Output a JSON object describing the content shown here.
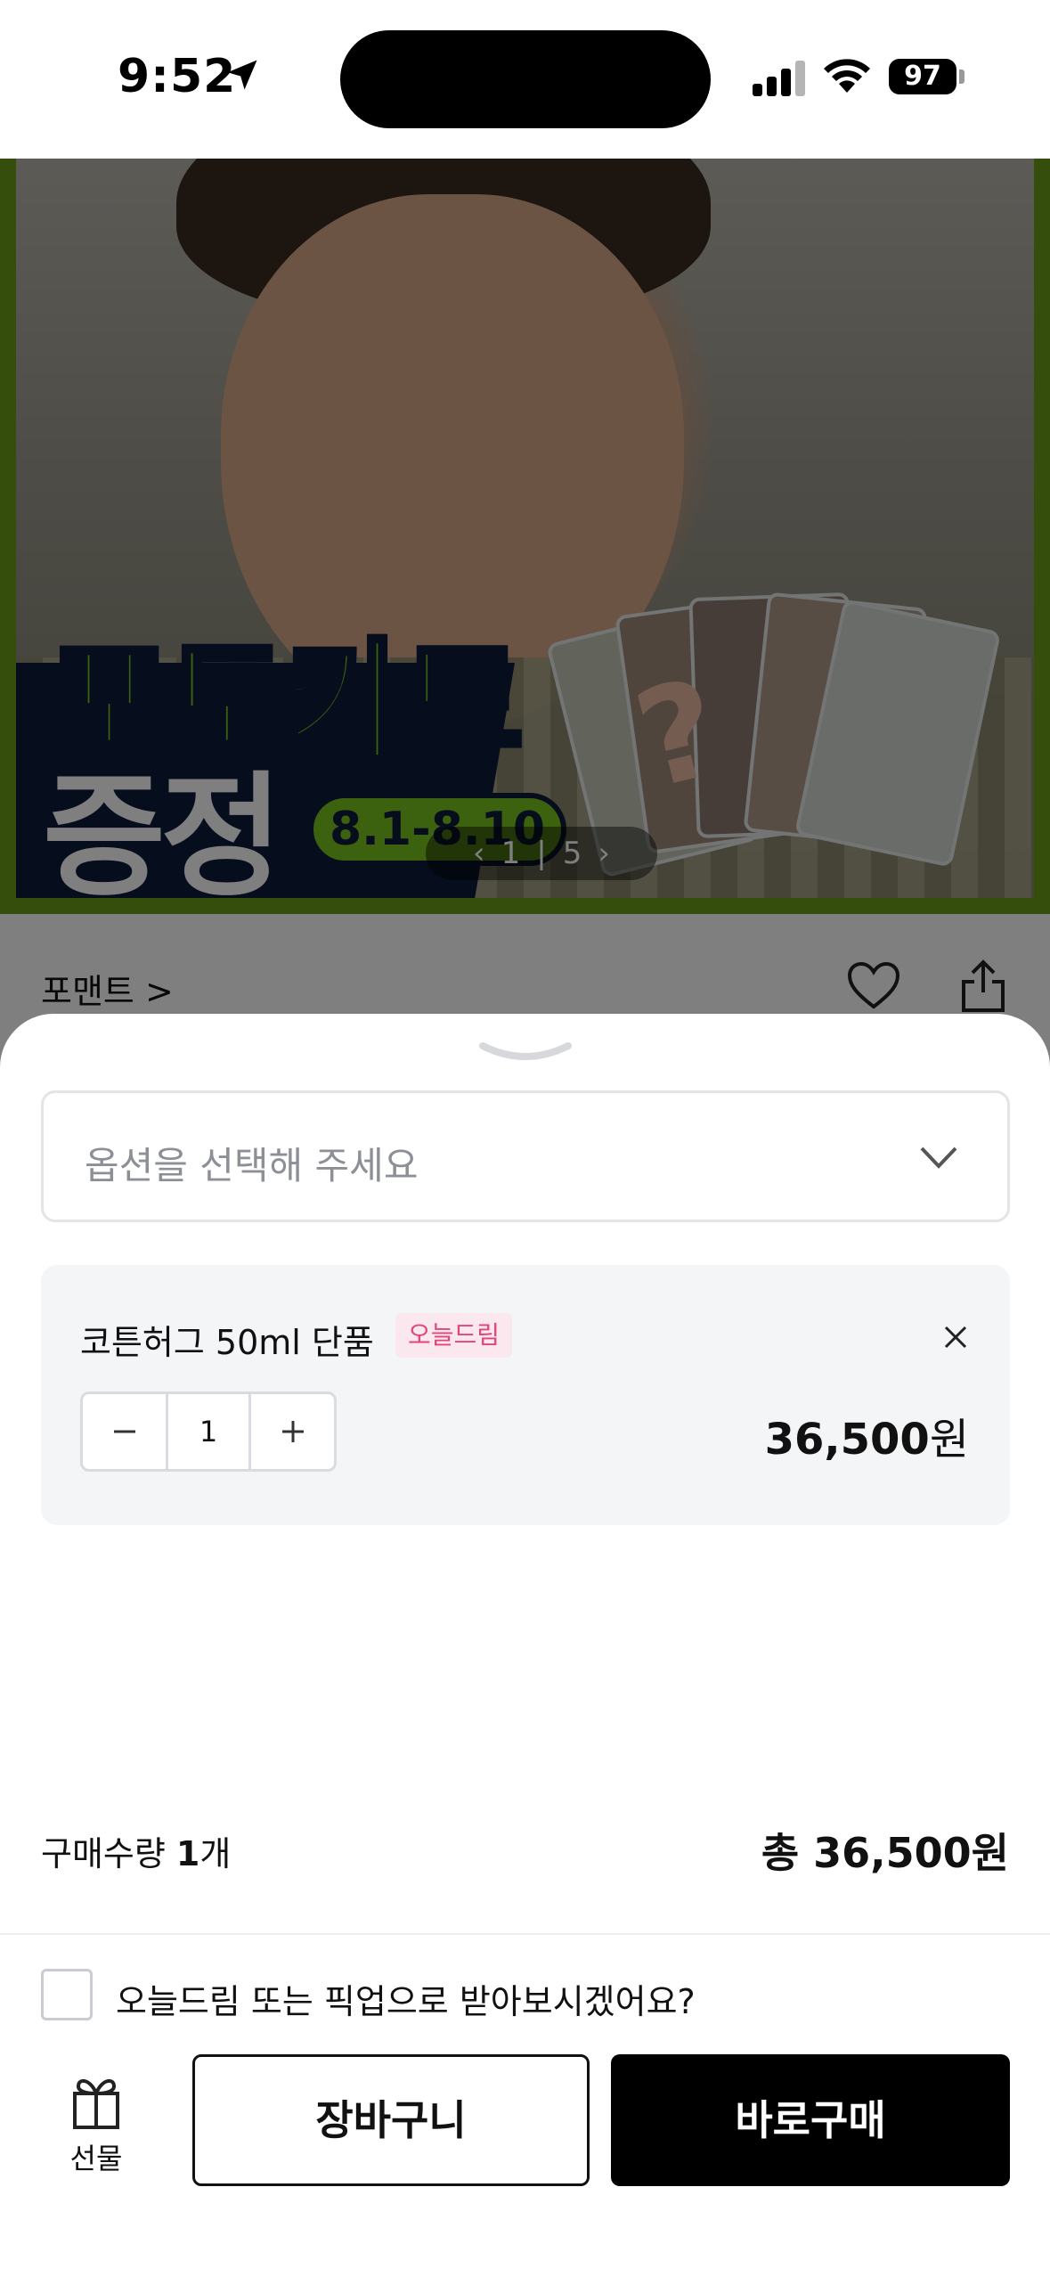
{
  "status_bar": {
    "time": "9:52",
    "battery": "97"
  },
  "banner": {
    "promo_line1": "포토카드",
    "promo_line2": "증정",
    "date_range": "8.1-8.10",
    "question_mark": "?",
    "indicator": {
      "prev": "‹",
      "current": "1",
      "separator": "|",
      "total": "5",
      "next": "›"
    },
    "colors": {
      "accent_green": "#7bc41e",
      "navy": "#0d1a3a"
    }
  },
  "product_header": {
    "brand": "포맨트 >"
  },
  "sheet": {
    "option_placeholder": "옵션을 선택해 주세요",
    "selected_item": {
      "name": "코튼허그 50ml 단품",
      "badge": "오늘드림",
      "quantity": "1",
      "price_amount": "36,500",
      "price_unit": "원"
    },
    "summary": {
      "qty_label": "구매수량 ",
      "qty_value": "1",
      "qty_unit": "개",
      "total": "총 36,500원"
    },
    "delivery_option_label": "오늘드림 또는 픽업으로 받아보시겠어요?",
    "gift_label": "선물",
    "cart_label": "장바구니",
    "buy_label": "바로구매",
    "colors": {
      "badge_text": "#e0457b",
      "badge_bg": "#fbe7ee",
      "primary": "#000000"
    }
  }
}
